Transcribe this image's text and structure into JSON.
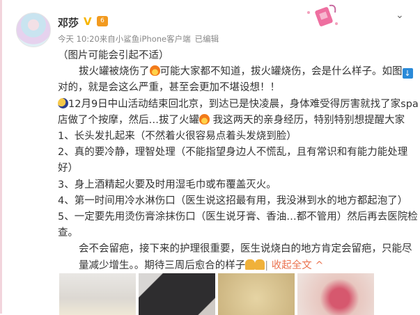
{
  "user": {
    "name": "邓莎",
    "verified_icon": "V",
    "badge": "6"
  },
  "meta": {
    "time": "今天 10:20",
    "source": "来自小鲨鱼iPhone客户端",
    "edited": "已编辑"
  },
  "post": {
    "lines": [
      "（图片可能会引起不适）",
      "拔火罐被烧伤了",
      "可能大家都不知道，拔火罐烧伤，会是什么样子。如图",
      "对的，就是会这么严重，甚至会更加不堪设想！！",
      "12月9日中山活动结束回北京，到达已是快凌晨，身体难受得厉害就找了家spa店做了个按摩，然后…拔了火罐",
      " 我这两天的亲身经历，特别特别想提醒大家",
      "1、长头发扎起来（不然着火很容易点着头发烧到脸）",
      "2、真的要冷静，理智处理（不能指望身边人不慌乱，且有常识和有能力能处理好）",
      "3、身上酒精起火要及时用湿毛巾或布覆盖灭火。",
      "4、第一时间用冷水淋伤口（医生说这招最有用，我没淋到水的地方都起泡了）",
      "5、一定要先用烫伤膏涂抹伤口（医生说牙膏、香油…都不管用）然后再去医院检查。",
      "会不会留疤，接下来的护理很重要，医生说烧白的地方肯定会留疤，只能尽量减少增生。。期待三周后愈合的样子"
    ],
    "arrow_emoji": "↓",
    "collapse_label": "收起全文 ^",
    "separator": "|"
  },
  "colors": {
    "accent": "#eb7350",
    "verified": "#f7b500"
  }
}
